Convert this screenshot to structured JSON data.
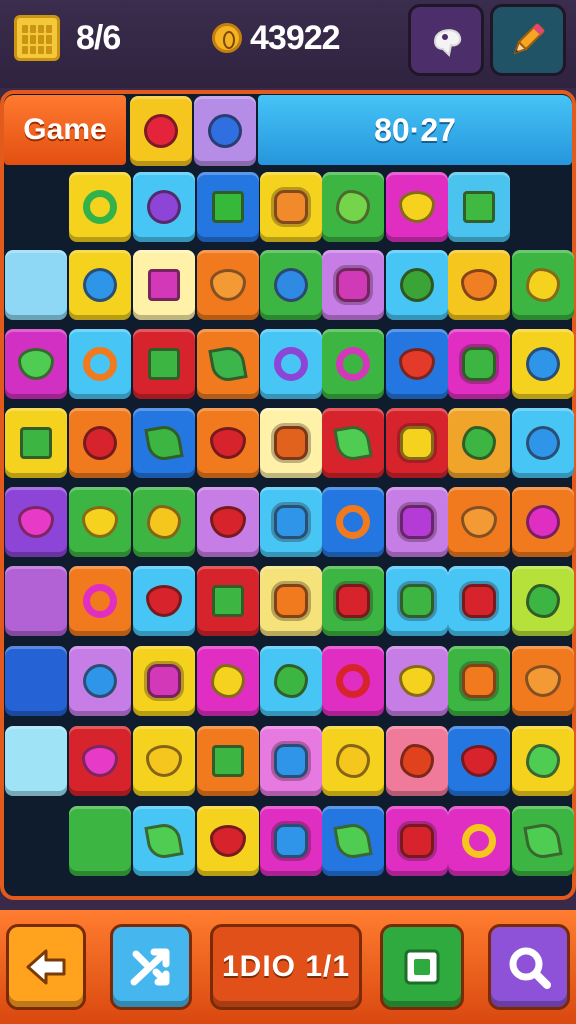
{
  "hud": {
    "lives": "8/6",
    "coins": "43922",
    "icons": {
      "lives": "calendar-icon",
      "coins": "coin-icon",
      "hint": "hint-icon",
      "edit": "pencil-icon"
    }
  },
  "header": {
    "mode_label": "Game",
    "timer": "80·27",
    "preview_tiles": [
      {
        "bg": "#f5c61d",
        "shape": "circle",
        "fg": "#e3243a"
      },
      {
        "bg": "#b58ce6",
        "shape": "circle",
        "fg": "#2f6fe0"
      }
    ]
  },
  "board": {
    "rows": [
      [
        null,
        {
          "bg": "#f5d21d",
          "shape": "ring",
          "fg": "#33b24a"
        },
        {
          "bg": "#47c6f5",
          "shape": "circle",
          "fg": "#8c45d6"
        },
        {
          "bg": "#2477e0",
          "shape": "square",
          "fg": "#36b83a"
        },
        {
          "bg": "#f5d21d",
          "shape": "flower",
          "fg": "#f08a2a"
        },
        {
          "bg": "#3db542",
          "shape": "blob",
          "fg": "#74d44a"
        },
        {
          "bg": "#e12ec2",
          "shape": "heart",
          "fg": "#f6d21e"
        },
        {
          "bg": "#4ac3ee",
          "shape": "square",
          "fg": "#3fb93f"
        },
        null
      ],
      [
        {
          "bg": "#8ed8f5",
          "shape": "none",
          "fg": ""
        },
        {
          "bg": "#f5d21d",
          "shape": "circle",
          "fg": "#2e95e8"
        },
        {
          "bg": "#fff2a8",
          "shape": "square",
          "fg": "#d338b9"
        },
        {
          "bg": "#f07a1d",
          "shape": "heart",
          "fg": "#f39a35"
        },
        {
          "bg": "#3db542",
          "shape": "circle",
          "fg": "#2f8ae3"
        },
        {
          "bg": "#c77de6",
          "shape": "flower",
          "fg": "#d13ab6"
        },
        {
          "bg": "#47c6f5",
          "shape": "circle",
          "fg": "#3aa536"
        },
        {
          "bg": "#f5c61d",
          "shape": "heart",
          "fg": "#f07f23"
        },
        {
          "bg": "#3db542",
          "shape": "blob",
          "fg": "#f5d21d"
        }
      ],
      [
        {
          "bg": "#d230c2",
          "shape": "heart",
          "fg": "#4fcc52"
        },
        {
          "bg": "#47c6f5",
          "shape": "ring",
          "fg": "#f07a1d"
        },
        {
          "bg": "#d7232b",
          "shape": "square",
          "fg": "#3db542"
        },
        {
          "bg": "#f07a1d",
          "shape": "leaf",
          "fg": "#3cb64a"
        },
        {
          "bg": "#47c6f5",
          "shape": "ring",
          "fg": "#8c45d6"
        },
        {
          "bg": "#3db542",
          "shape": "ring",
          "fg": "#d338b9"
        },
        {
          "bg": "#2477e0",
          "shape": "heart",
          "fg": "#e33a2a"
        },
        {
          "bg": "#e12ec2",
          "shape": "flower",
          "fg": "#3db542"
        },
        {
          "bg": "#f5d21d",
          "shape": "circle",
          "fg": "#2e95e8"
        }
      ],
      [
        {
          "bg": "#f5d21d",
          "shape": "square",
          "fg": "#3db542"
        },
        {
          "bg": "#f07a1d",
          "shape": "circle",
          "fg": "#d7232b"
        },
        {
          "bg": "#2477e0",
          "shape": "leaf",
          "fg": "#3db542"
        },
        {
          "bg": "#f07a1d",
          "shape": "heart",
          "fg": "#d7232b"
        },
        {
          "bg": "#fff2a8",
          "shape": "flower",
          "fg": "#e0621d"
        },
        {
          "bg": "#d7232b",
          "shape": "leaf",
          "fg": "#4fcc52"
        },
        {
          "bg": "#d7232b",
          "shape": "flower",
          "fg": "#f5d21d"
        },
        {
          "bg": "#f0a42a",
          "shape": "blob",
          "fg": "#3db542"
        },
        {
          "bg": "#47c6f5",
          "shape": "circle",
          "fg": "#2e95e8"
        }
      ],
      [
        {
          "bg": "#8c45d6",
          "shape": "heart",
          "fg": "#e73ac6"
        },
        {
          "bg": "#3db542",
          "shape": "heart",
          "fg": "#f5d21d"
        },
        {
          "bg": "#3db542",
          "shape": "blob",
          "fg": "#f5c61d"
        },
        {
          "bg": "#c77de6",
          "shape": "heart",
          "fg": "#d7232b"
        },
        {
          "bg": "#47c6f5",
          "shape": "flower",
          "fg": "#2e95e8"
        },
        {
          "bg": "#2477e0",
          "shape": "ring",
          "fg": "#f07a1d"
        },
        {
          "bg": "#c77de6",
          "shape": "flower",
          "fg": "#b53bd6"
        },
        {
          "bg": "#f07a1d",
          "shape": "heart",
          "fg": "#f39a35"
        },
        {
          "bg": "#f07a1d",
          "shape": "circle",
          "fg": "#e12ec2"
        }
      ],
      [
        {
          "bg": "#b362d6",
          "shape": "none",
          "fg": ""
        },
        {
          "bg": "#f07a1d",
          "shape": "ring",
          "fg": "#e12ec2"
        },
        {
          "bg": "#47c6f5",
          "shape": "heart",
          "fg": "#d7232b"
        },
        {
          "bg": "#d7232b",
          "shape": "square",
          "fg": "#3db542"
        },
        {
          "bg": "#f5e27a",
          "shape": "flower",
          "fg": "#f07a1d"
        },
        {
          "bg": "#3db542",
          "shape": "flower",
          "fg": "#d7232b"
        },
        {
          "bg": "#47c6f5",
          "shape": "flower",
          "fg": "#3db542"
        },
        {
          "bg": "#47c6f5",
          "shape": "flower",
          "fg": "#d7232b"
        },
        {
          "bg": "#b6e03a",
          "shape": "blob",
          "fg": "#3db542"
        }
      ],
      [
        {
          "bg": "#2462d6",
          "shape": "none",
          "fg": ""
        },
        {
          "bg": "#c77de6",
          "shape": "circle",
          "fg": "#2e95e8"
        },
        {
          "bg": "#f5d21d",
          "shape": "flower",
          "fg": "#d338b9"
        },
        {
          "bg": "#e12ec2",
          "shape": "blob",
          "fg": "#f5d21d"
        },
        {
          "bg": "#47c6f5",
          "shape": "blob",
          "fg": "#3db542"
        },
        {
          "bg": "#e12ec2",
          "shape": "ring",
          "fg": "#d7232b"
        },
        {
          "bg": "#c77de6",
          "shape": "heart",
          "fg": "#f5d21d"
        },
        {
          "bg": "#3db542",
          "shape": "flower",
          "fg": "#f07a1d"
        },
        {
          "bg": "#f07a1d",
          "shape": "heart",
          "fg": "#f39a35"
        }
      ],
      [
        {
          "bg": "#9fe3f6",
          "shape": "none",
          "fg": ""
        },
        {
          "bg": "#d7232b",
          "shape": "heart",
          "fg": "#e73ac6"
        },
        {
          "bg": "#f5d21d",
          "shape": "heart",
          "fg": "#f5c61d"
        },
        {
          "bg": "#f07a1d",
          "shape": "square",
          "fg": "#3db542"
        },
        {
          "bg": "#e77ae0",
          "shape": "flower",
          "fg": "#2e95e8"
        },
        {
          "bg": "#f5d21d",
          "shape": "blob",
          "fg": "#f5c61d"
        },
        {
          "bg": "#f07a9a",
          "shape": "blob",
          "fg": "#e0421d"
        },
        {
          "bg": "#2477e0",
          "shape": "heart",
          "fg": "#d7232b"
        },
        {
          "bg": "#f5d21d",
          "shape": "blob",
          "fg": "#4fcc52"
        }
      ],
      [
        null,
        {
          "bg": "#3db542",
          "shape": "none",
          "fg": ""
        },
        {
          "bg": "#47c6f5",
          "shape": "leaf",
          "fg": "#4fcc52"
        },
        {
          "bg": "#f5d21d",
          "shape": "heart",
          "fg": "#d7232b"
        },
        {
          "bg": "#e12ec2",
          "shape": "flower",
          "fg": "#2e95e8"
        },
        {
          "bg": "#2477e0",
          "shape": "leaf",
          "fg": "#4fcc52"
        },
        {
          "bg": "#e12ec2",
          "shape": "flower",
          "fg": "#d7232b"
        },
        {
          "bg": "#e12ec2",
          "shape": "ring",
          "fg": "#f5c61d"
        },
        {
          "bg": "#3db542",
          "shape": "leaf",
          "fg": "#4fcc52"
        }
      ]
    ]
  },
  "bottom": {
    "counter": "1DIO 1/1",
    "icons": {
      "back": "back-arrow-icon",
      "shuffle": "shuffle-icon",
      "frame": "frame-icon",
      "search": "magnifier-icon"
    }
  }
}
